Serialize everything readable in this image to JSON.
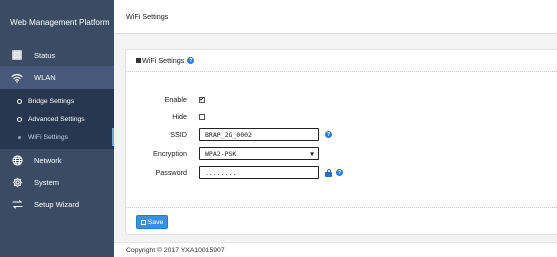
{
  "sidebar": {
    "brand": "Web Management Platform",
    "items": [
      {
        "label": "Status",
        "icon": "grid-icon"
      },
      {
        "label": "WLAN",
        "icon": "wifi-icon"
      },
      {
        "label": "Network",
        "icon": "globe-icon"
      },
      {
        "label": "System",
        "icon": "gear-icon"
      },
      {
        "label": "Setup Wizard",
        "icon": "wizard-icon"
      }
    ],
    "wlan_sub": [
      {
        "label": "Bridge Settings"
      },
      {
        "label": "Advanced Settings"
      },
      {
        "label": "WiFi Settings"
      }
    ]
  },
  "topbar": {
    "title": "WiFi Settings"
  },
  "panel": {
    "title": "WiFi Settings",
    "fields": {
      "enable": {
        "label": "Enable",
        "checked": "✔"
      },
      "hide": {
        "label": "Hide",
        "checked": ""
      },
      "ssid": {
        "label": "SSID",
        "value": "BRAP_2G_0002"
      },
      "encryption": {
        "label": "Encryption",
        "value": "WPA2-PSK"
      },
      "password": {
        "label": "Password",
        "value": "........"
      }
    },
    "save_label": "Save"
  },
  "footer": {
    "copyright": "Copyright © 2017  YXA10015907"
  },
  "colors": {
    "sidebar": "#3a4b63",
    "submenu": "#28374f",
    "accent": "#3b8ee0"
  }
}
